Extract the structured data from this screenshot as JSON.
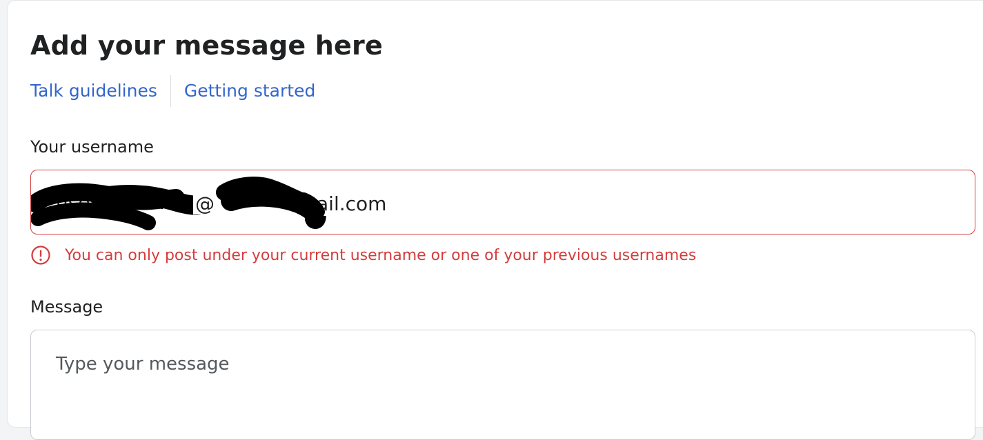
{
  "form": {
    "title": "Add your message here",
    "links": [
      {
        "label": "Talk guidelines"
      },
      {
        "label": "Getting started"
      }
    ],
    "username": {
      "label": "Your username",
      "value": "user@mail.com",
      "visible_fragments": [
        "@",
        "ail.com"
      ],
      "error": "You can only post under your current username or one of your previous usernames",
      "error_color": "#d33d3d"
    },
    "message": {
      "label": "Message",
      "placeholder": "Type your message"
    }
  },
  "colors": {
    "link": "#3366cc",
    "error": "#d33d3d",
    "text": "#202122",
    "border": "#c8ccd1"
  }
}
